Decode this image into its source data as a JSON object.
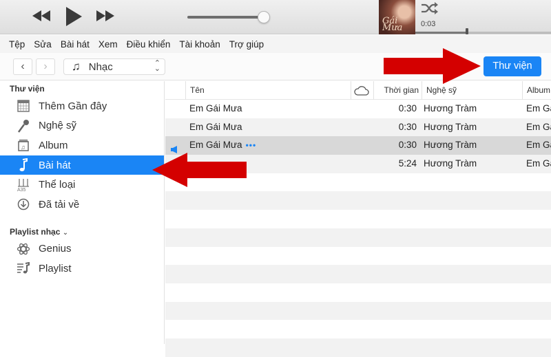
{
  "player": {
    "controls": {
      "rewind": "rewind",
      "play": "play",
      "forward": "fast-forward"
    },
    "volume_level": 0.95,
    "now_playing": {
      "art_text": "Gái Mưa",
      "elapsed": "0:03",
      "progress": 0.37
    },
    "shuffle_icon": "shuffle-icon"
  },
  "menu": [
    "Tệp",
    "Sửa",
    "Bài hát",
    "Xem",
    "Điều khiển",
    "Tài khoản",
    "Trợ giúp"
  ],
  "toolbar": {
    "back": "‹",
    "forward": "›",
    "media_type": "Nhạc",
    "library_button": "Thư viện"
  },
  "sidebar": {
    "library_header": "Thư viện",
    "library_items": [
      {
        "label": "Thêm Gần đây",
        "icon": "calendar-grid-icon"
      },
      {
        "label": "Nghệ sỹ",
        "icon": "microphone-icon"
      },
      {
        "label": "Album",
        "icon": "album-icon"
      },
      {
        "label": "Bài hát",
        "icon": "music-note-icon",
        "active": true
      },
      {
        "label": "Thể loại",
        "icon": "genre-icon"
      },
      {
        "label": "Đã tải về",
        "icon": "download-circle-icon"
      }
    ],
    "playlist_header": "Playlist nhạc",
    "playlist_items": [
      {
        "label": "Genius",
        "icon": "atom-icon"
      },
      {
        "label": "Playlist",
        "icon": "playlist-icon"
      }
    ]
  },
  "table": {
    "columns": {
      "name": "Tên",
      "cloud": "cloud-icon",
      "time": "Thời gian",
      "artist": "Nghệ sỹ",
      "album": "Album"
    },
    "rows": [
      {
        "name": "Em Gái Mưa",
        "time": "0:30",
        "artist": "Hương Tràm",
        "album": "Em Gái Mưa",
        "playing": false
      },
      {
        "name": "Em Gái Mưa",
        "time": "0:30",
        "artist": "Hương Tràm",
        "album": "Em Gái Mưa",
        "playing": false
      },
      {
        "name": "Em Gái Mưa",
        "time": "0:30",
        "artist": "Hương Tràm",
        "album": "Em Gái Mưa",
        "playing": true,
        "more": "•••"
      },
      {
        "name": "",
        "time": "5:24",
        "artist": "Hương Tràm",
        "album": "Em Gái Mưa",
        "playing": false
      }
    ]
  },
  "annotations": {
    "arrow_color": "#d40000"
  }
}
